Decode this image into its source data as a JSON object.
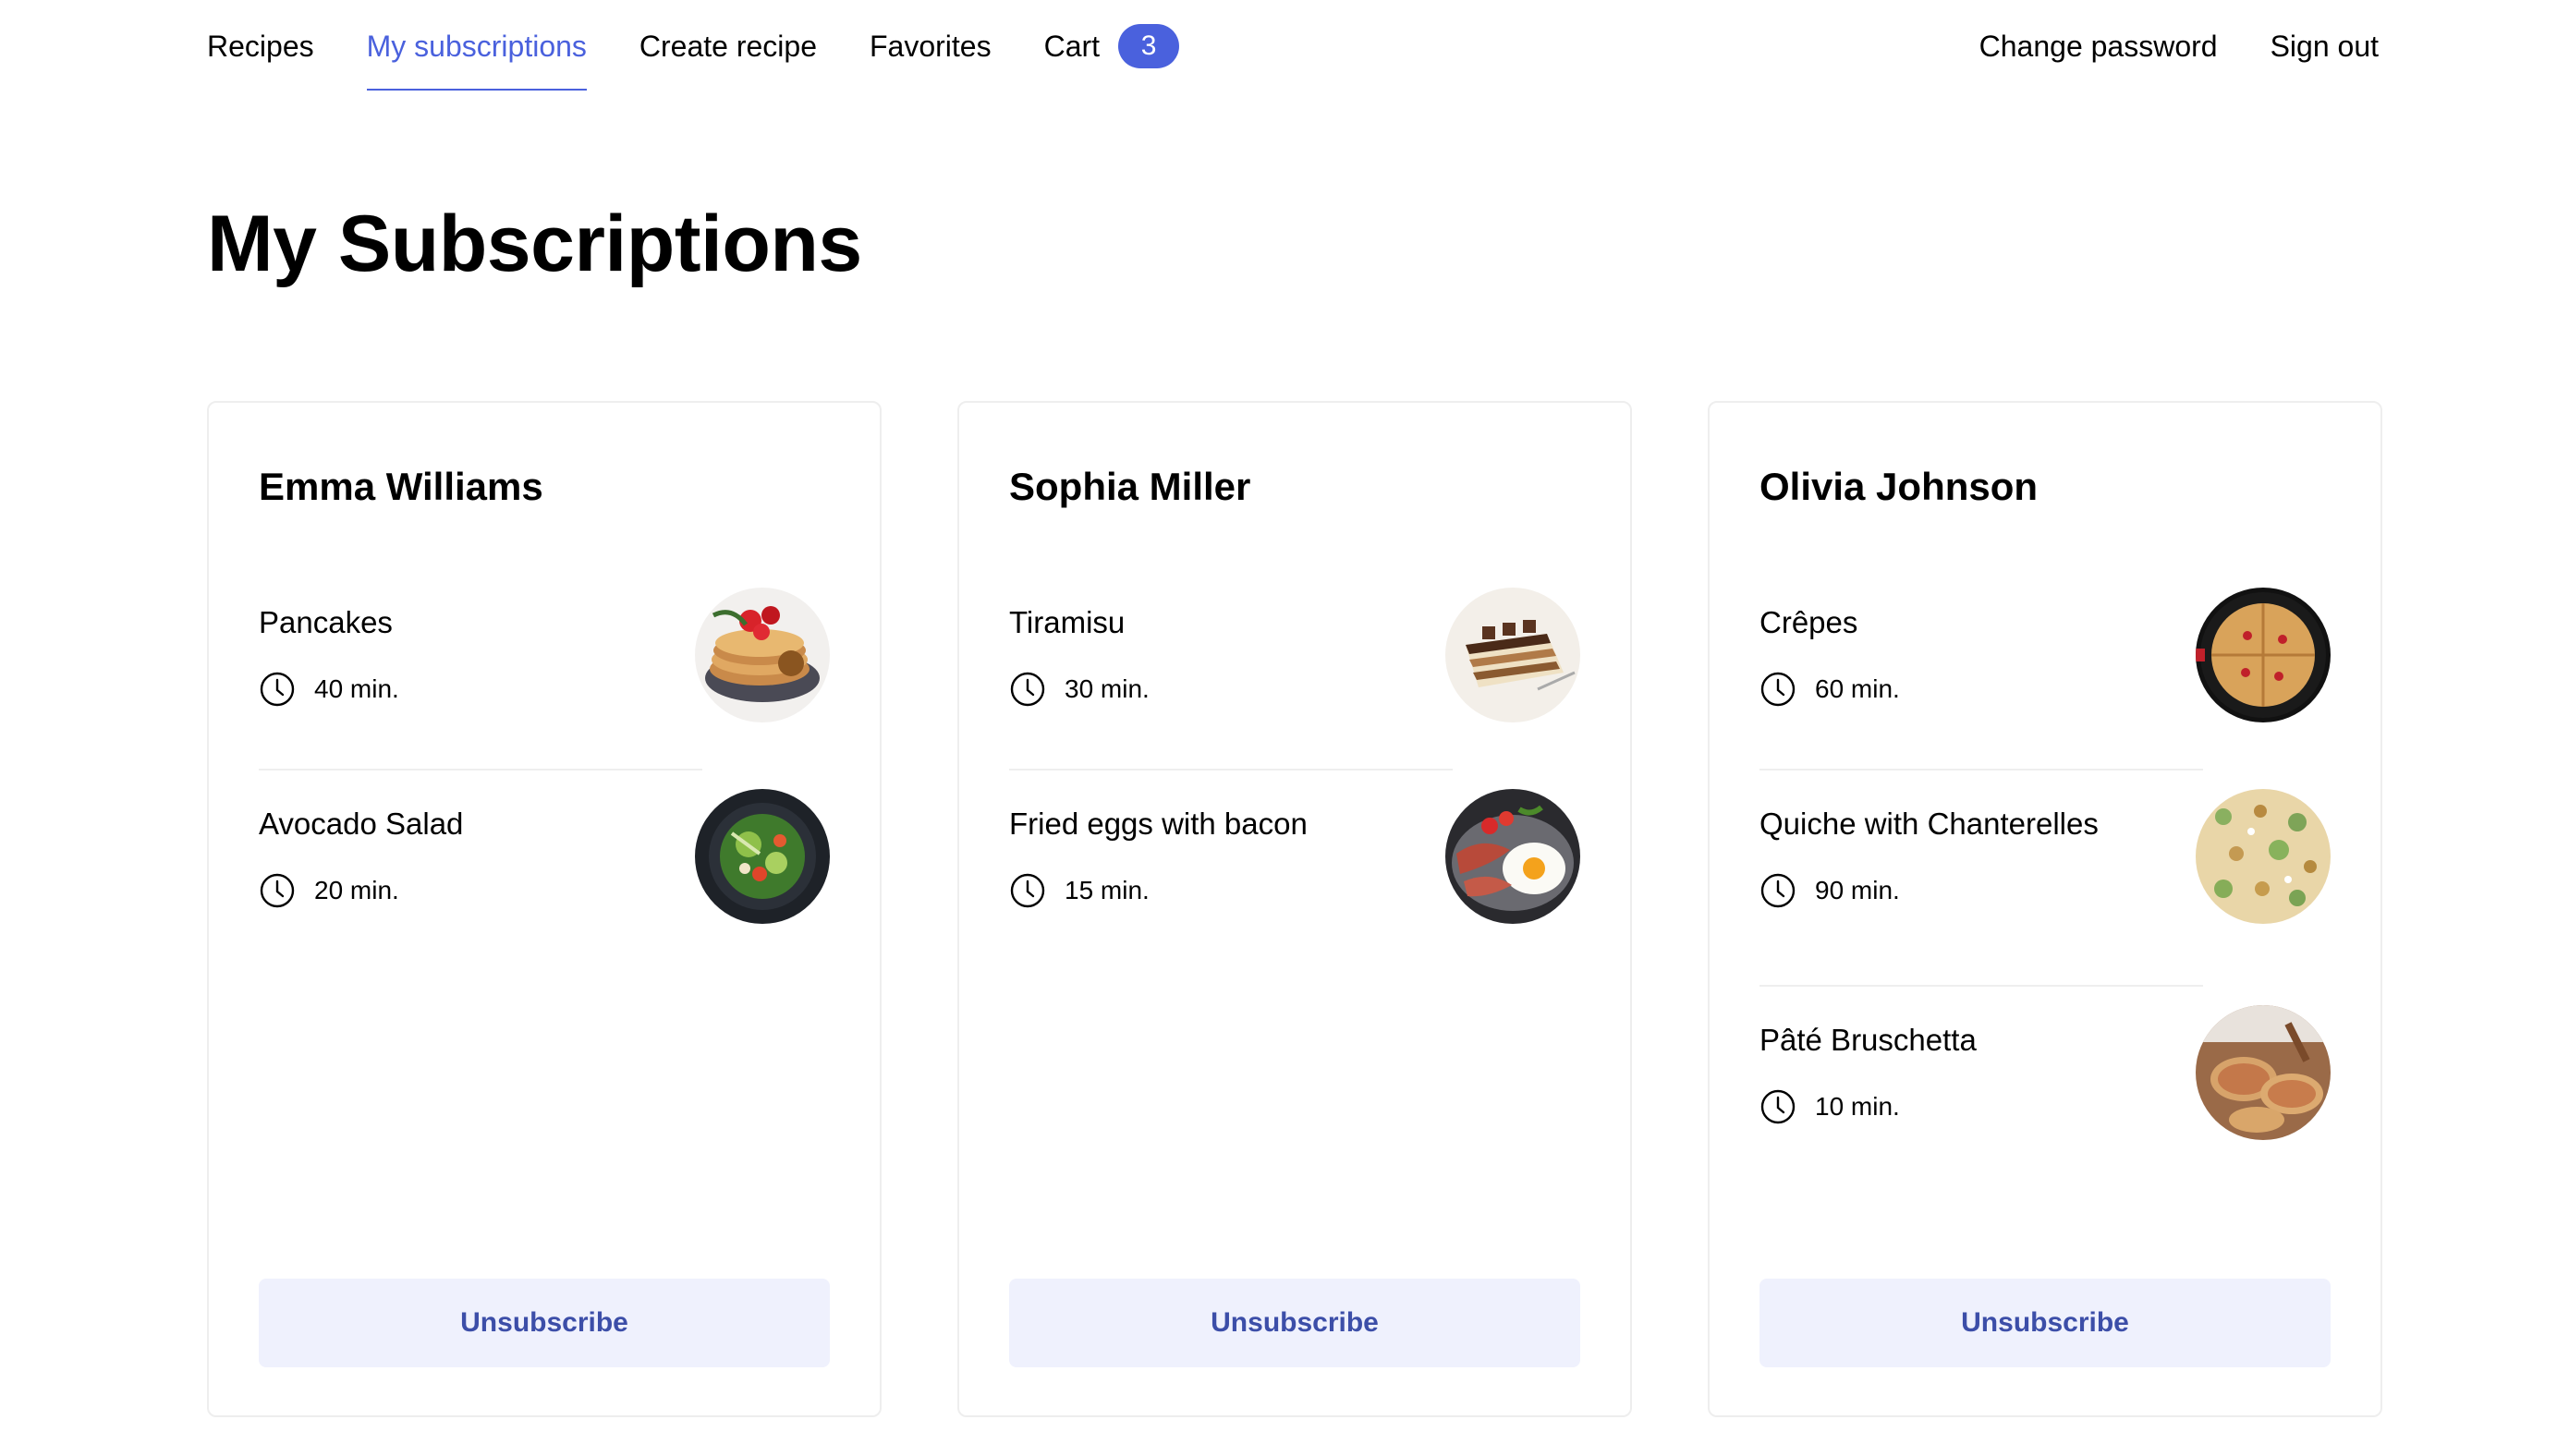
{
  "nav": {
    "recipes": "Recipes",
    "subscriptions": "My subscriptions",
    "create": "Create recipe",
    "favorites": "Favorites",
    "cart": "Cart",
    "cart_count": "3",
    "change_password": "Change password",
    "sign_out": "Sign out"
  },
  "page_title": "My Subscriptions",
  "accent_color": "#4a61dd",
  "cards": [
    {
      "author": "Emma Williams",
      "recipes": [
        {
          "name": "Pancakes",
          "time": "40 min."
        },
        {
          "name": "Avocado Salad",
          "time": "20 min."
        }
      ],
      "button": "Unsubscribe"
    },
    {
      "author": "Sophia Miller",
      "recipes": [
        {
          "name": "Tiramisu",
          "time": "30 min."
        },
        {
          "name": "Fried eggs with bacon",
          "time": "15 min."
        }
      ],
      "button": "Unsubscribe"
    },
    {
      "author": "Olivia Johnson",
      "recipes": [
        {
          "name": "Crêpes",
          "time": "60 min."
        },
        {
          "name": "Quiche with Chanterelles",
          "time": "90 min."
        },
        {
          "name": "Pâté Bruschetta",
          "time": "10 min."
        }
      ],
      "button": "Unsubscribe"
    }
  ]
}
